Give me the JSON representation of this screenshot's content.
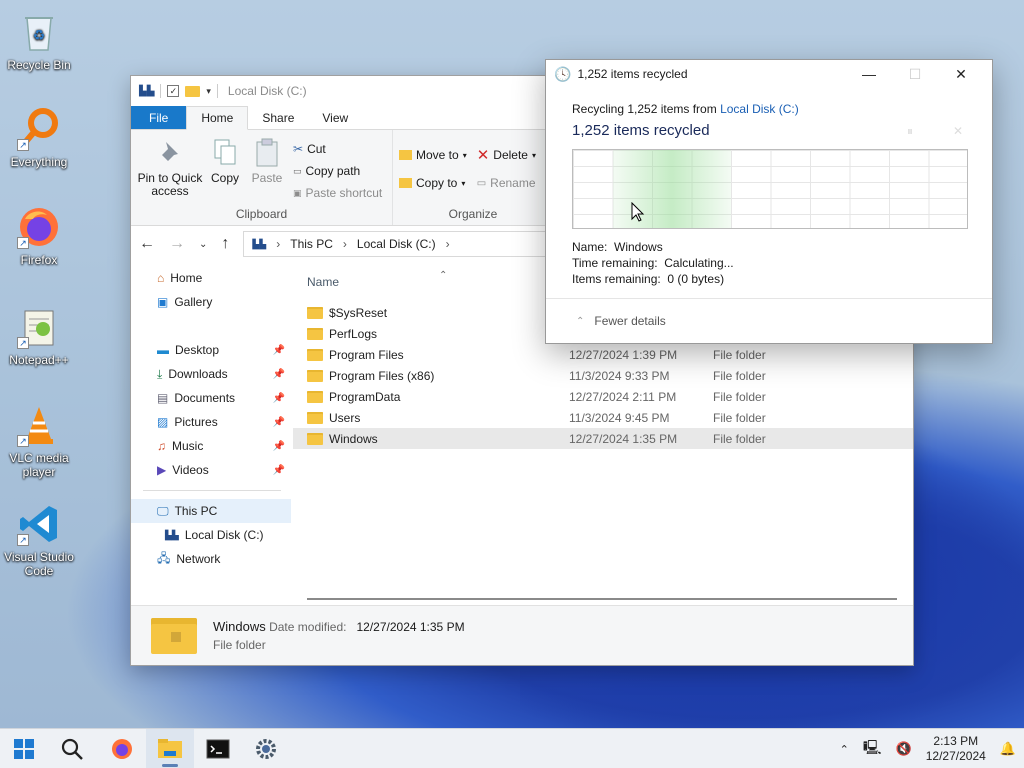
{
  "desktop": {
    "icons": [
      {
        "label": "Recycle Bin"
      },
      {
        "label": "Everything"
      },
      {
        "label": "Firefox"
      },
      {
        "label": "Notepad++"
      },
      {
        "label": "VLC media player"
      },
      {
        "label": "Visual Studio Code"
      }
    ]
  },
  "explorer": {
    "title": "Local Disk (C:)",
    "tabs": [
      "File",
      "Home",
      "Share",
      "View"
    ],
    "active_tab": "Home",
    "clipboard": {
      "pin_label": "Pin to Quick access",
      "copy_label": "Copy",
      "paste_label": "Paste",
      "cut_label": "Cut",
      "copy_path_label": "Copy path",
      "paste_shortcut_label": "Paste shortcut",
      "group_label": "Clipboard"
    },
    "organize": {
      "move_to_label": "Move to",
      "copy_to_label": "Copy to",
      "delete_label": "Delete",
      "rename_label": "Rename",
      "group_label": "Organize"
    },
    "breadcrumb": [
      "This PC",
      "Local Disk (C:)"
    ],
    "nav": {
      "home": "Home",
      "gallery": "Gallery",
      "quick": [
        "Desktop",
        "Downloads",
        "Documents",
        "Pictures",
        "Music",
        "Videos"
      ],
      "this_pc": "This PC",
      "local_disk": "Local Disk (C:)",
      "network": "Network"
    },
    "column_name": "Name",
    "files": [
      {
        "name": "$SysReset",
        "date": "",
        "type": ""
      },
      {
        "name": "PerfLogs",
        "date": "",
        "type": ""
      },
      {
        "name": "Program Files",
        "date": "12/27/2024 1:39 PM",
        "type": "File folder"
      },
      {
        "name": "Program Files (x86)",
        "date": "11/3/2024 9:33 PM",
        "type": "File folder"
      },
      {
        "name": "ProgramData",
        "date": "12/27/2024 2:11 PM",
        "type": "File folder"
      },
      {
        "name": "Users",
        "date": "11/3/2024 9:45 PM",
        "type": "File folder"
      },
      {
        "name": "Windows",
        "date": "12/27/2024 1:35 PM",
        "type": "File folder"
      }
    ],
    "details": {
      "name": "Windows",
      "date_label": "Date modified:",
      "date_value": "12/27/2024 1:35 PM",
      "type": "File folder"
    }
  },
  "dialog": {
    "title": "1,252 items recycled",
    "line1_prefix": "Recycling 1,252 items from",
    "line1_link": "Local Disk (C:)",
    "heading": "1,252 items recycled",
    "name_label": "Name:",
    "name_value": "Windows",
    "time_label": "Time remaining:",
    "time_value": "Calculating...",
    "items_label": "Items remaining:",
    "items_value": "0 (0 bytes)",
    "fewer_details": "Fewer details"
  },
  "taskbar": {
    "time": "2:13 PM",
    "date": "12/27/2024"
  },
  "colors": {
    "accent": "#1979ca",
    "link": "#1a5fb4"
  }
}
